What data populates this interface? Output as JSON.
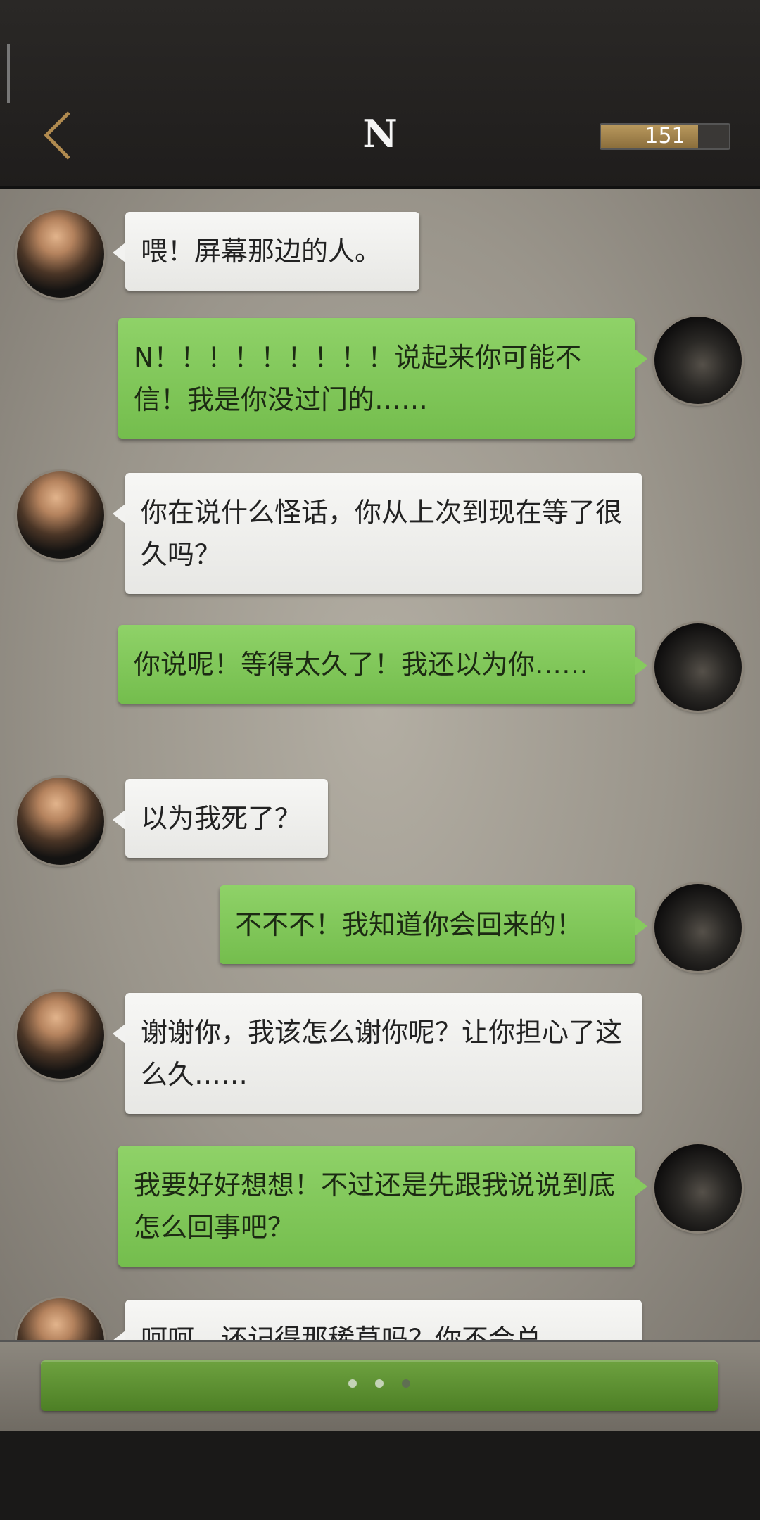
{
  "header": {
    "title": "N",
    "score": "151",
    "score_fraction": 0.76
  },
  "messages": [
    {
      "side": "left",
      "text": "喂！屏幕那边的人。"
    },
    {
      "side": "right",
      "text": "N！！！！！！！！！说起来你可能不信！我是你没过门的……"
    },
    {
      "side": "left",
      "text": "你在说什么怪话，你从上次到现在等了很久吗？"
    },
    {
      "side": "right",
      "text": "你说呢！等得太久了！我还以为你……"
    },
    {
      "side": "left",
      "text": "以为我死了？"
    },
    {
      "side": "right",
      "text": "不不不！我知道你会回来的！"
    },
    {
      "side": "left",
      "text": "谢谢你，我该怎么谢你呢？让你担心了这么久……"
    },
    {
      "side": "right",
      "text": "我要好好想想！不过还是先跟我说说到底怎么回事吧？"
    },
    {
      "side": "left",
      "text": "呵呵，还记得那稀草吗？你不会总"
    }
  ],
  "colors": {
    "bubble_left": "#f2f2f0",
    "bubble_right": "#86cb5e",
    "input_bar": "#5e9133"
  },
  "icons": {
    "back": "chevron-left-icon",
    "typing": "typing-dots-icon"
  }
}
